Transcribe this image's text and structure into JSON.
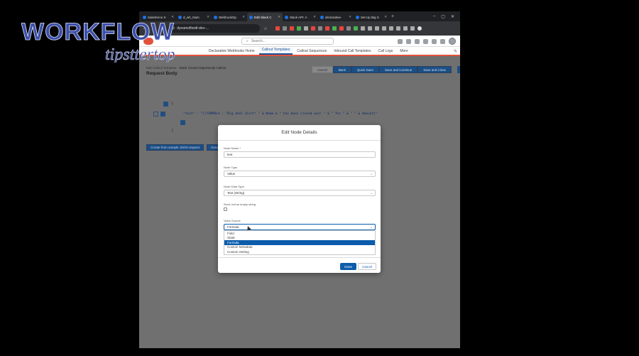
{
  "browser": {
    "tabs": [
      {
        "label": "Salesforce S",
        "active": false
      },
      {
        "label": "d_wh_Nam",
        "active": false
      },
      {
        "label": "WebhookOp",
        "active": false
      },
      {
        "label": "Edit Slack C",
        "active": true
      },
      {
        "label": "Slack API: A",
        "active": false
      },
      {
        "label": "declarative-",
        "active": false
      },
      {
        "label": "Set Up Big S",
        "active": false
      }
    ],
    "new_tab": "+",
    "win_controls": [
      "–",
      "▢",
      "✕"
    ],
    "url": "dynamoflowtl-dev-..."
  },
  "sf": {
    "search_placeholder": "Search...",
    "nav": [
      {
        "label": "Declarative Webhooks Home",
        "active": false
      },
      {
        "label": "Callout Templates",
        "active": true
      },
      {
        "label": "Callout Sequences",
        "active": false
      },
      {
        "label": "Inbound Call Templates",
        "active": false
      },
      {
        "label": "Call Logs",
        "active": false
      },
      {
        "label": "More",
        "active": false
      }
    ],
    "record_kind": "Edit Callout Template",
    "record_name": "Slack Closed Opportunity Callout",
    "record_title": "Request Body",
    "actions": [
      "Cancel",
      "Back",
      "Quick Save",
      "Save and Continue",
      "Save and Close"
    ],
    "brace_open": "{",
    "brace_close": "}",
    "json_line": "\"text\" : \"{!FORMULA : \"Big deal alert! \" & Name & \" has been closed won! \" & \" for \" & \" \" & Amount}\"",
    "json_buttons": [
      "Create from sample JSON request",
      "Gene"
    ]
  },
  "modal": {
    "title": "Edit Node Details",
    "fields": [
      {
        "label": "Node Name *",
        "value": "text",
        "type": "input"
      },
      {
        "label": "Node Type",
        "value": "Value",
        "type": "select"
      },
      {
        "label": "Node Data Type",
        "value": "Text (String)",
        "type": "select"
      }
    ],
    "checkbox_label": "Send null as empty string",
    "value_source_label": "Value Source",
    "value_source_selected": "Formula",
    "value_source_options": [
      {
        "label": "Field",
        "selected": false
      },
      {
        "label": "Static",
        "selected": false
      },
      {
        "label": "Formula",
        "selected": true
      },
      {
        "label": "Custom Metadata",
        "selected": false
      },
      {
        "label": "Custom Setting",
        "selected": false
      }
    ],
    "done_label": "Done",
    "cancel_label": "Cancel"
  },
  "watermark": {
    "line1": "WORKFLOW",
    "line2": "tipsttertop"
  },
  "colors": {
    "accent": "#0b5cab",
    "brand": "#e1523d",
    "header": "#202124"
  }
}
